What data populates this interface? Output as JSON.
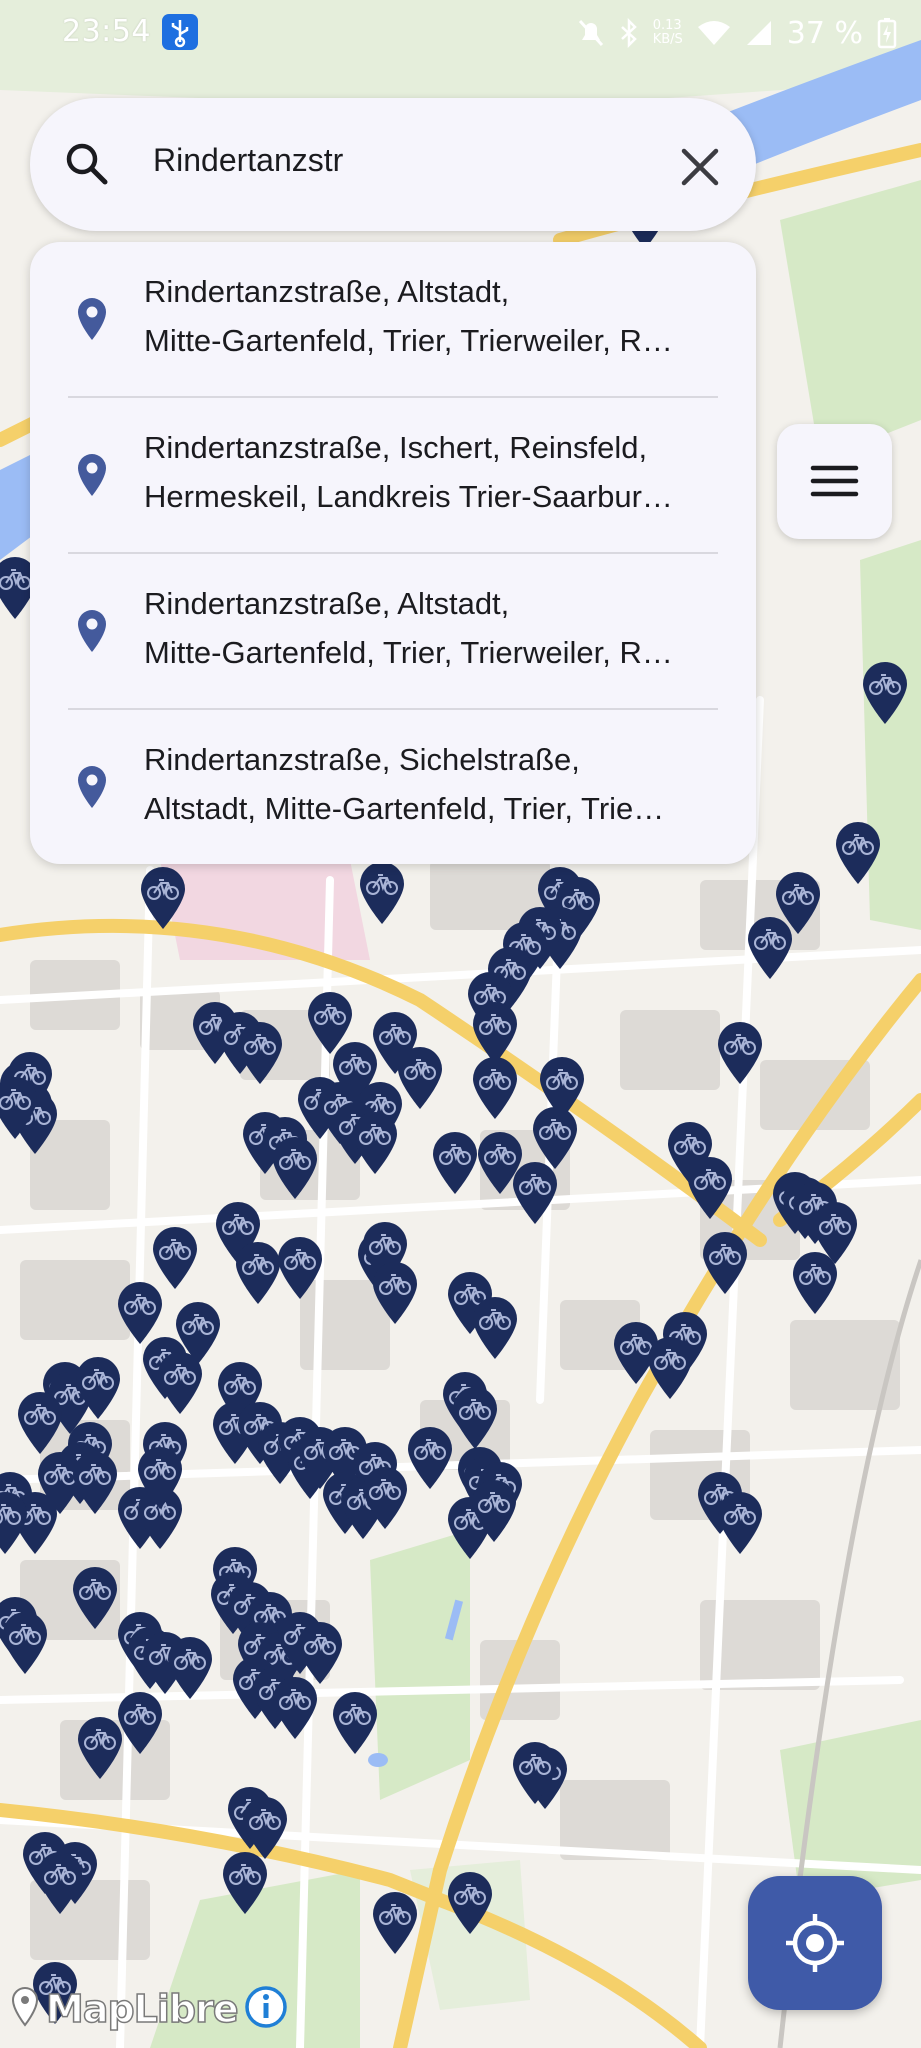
{
  "status": {
    "time": "23:54",
    "data_speed": "0.13\nKB/S",
    "battery": "37 %"
  },
  "search": {
    "query": "Rindertanzstr"
  },
  "suggestions": [
    {
      "line1": "Rindertanzstraße, Altstadt,",
      "line2": "Mitte-Gartenfeld, Trier, Trierweiler, R…"
    },
    {
      "line1": "Rindertanzstraße, Ischert, Reinsfeld,",
      "line2": "Hermeskeil, Landkreis Trier-Saarbur…"
    },
    {
      "line1": "Rindertanzstraße, Altstadt,",
      "line2": "Mitte-Gartenfeld, Trier, Trierweiler, R…"
    },
    {
      "line1": "Rindertanzstraße, Sichelstraße,",
      "line2": "Altstadt, Mitte-Gartenfeld, Trier, Trie…"
    }
  ],
  "map": {
    "attribution": "MapLibre",
    "marker_icon": "bicycle-pin-icon",
    "colors": {
      "marker": "#1c2c5b",
      "road_major": "#f5d06a",
      "river": "#9bbcf5",
      "park": "#d6e9c6",
      "building": "#dddad6",
      "background": "#f3f1ec"
    }
  },
  "colors": {
    "surface": "#f6f5fc",
    "locate_button": "#3f5aa8",
    "pin": "#445a9c"
  }
}
